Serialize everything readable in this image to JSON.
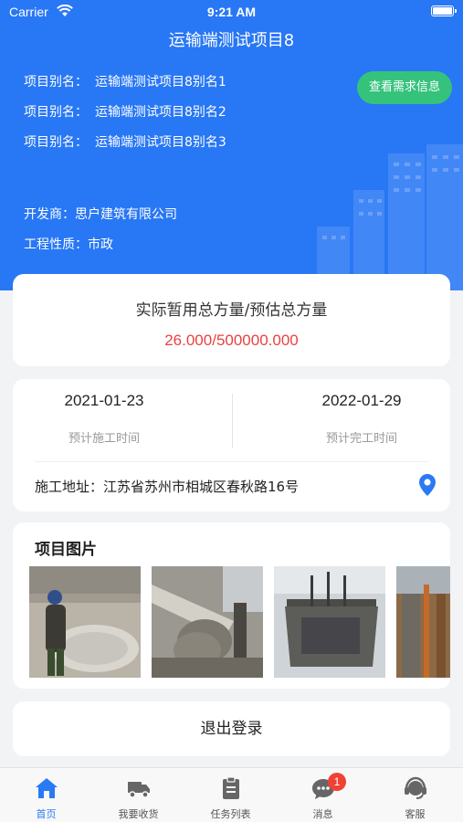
{
  "status_bar": {
    "carrier": "Carrier",
    "time": "9:21 AM"
  },
  "header": {
    "title": "运输端测试项目8",
    "alias_label": "项目别名：",
    "aliases": [
      "运输端测试项目8别名1",
      "运输端测试项目8别名2",
      "运输端测试项目8别名3"
    ],
    "demand_button": "查看需求信息",
    "developer_label": "开发商：",
    "developer": "思户建筑有限公司",
    "nature_label": "工程性质：",
    "nature": "市政"
  },
  "volume": {
    "title": "实际暂用总方量/预估总方量",
    "value": "26.000/500000.000"
  },
  "schedule": {
    "start_date": "2021-01-23",
    "start_label": "预计施工时间",
    "end_date": "2022-01-29",
    "end_label": "预计完工时间",
    "address_label": "施工地址：",
    "address": "江苏省苏州市相城区春秋路16号"
  },
  "photos": {
    "title": "项目图片"
  },
  "logout": {
    "label": "退出登录"
  },
  "tabbar": {
    "items": [
      {
        "label": "首页",
        "icon": "home-icon"
      },
      {
        "label": "我要收货",
        "icon": "truck-icon"
      },
      {
        "label": "任务列表",
        "icon": "clipboard-icon"
      },
      {
        "label": "消息",
        "icon": "chat-icon",
        "badge": "1"
      },
      {
        "label": "客服",
        "icon": "headset-icon"
      }
    ]
  },
  "colors": {
    "primary": "#2877f5",
    "accent_green": "#35c37c",
    "value_red": "#e8423f",
    "badge_red": "#f04134"
  }
}
